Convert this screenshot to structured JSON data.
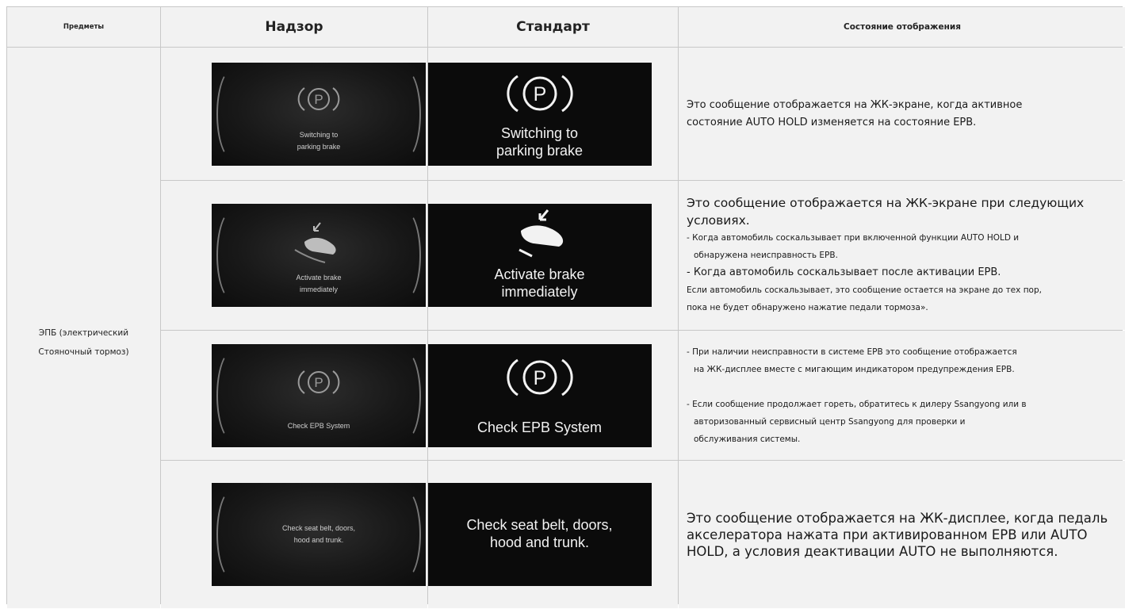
{
  "header": {
    "items": "Предметы",
    "supervision": "Надзор",
    "standard": "Стандарт",
    "display_state": "Состояние отображения"
  },
  "item": {
    "line1": "ЭПБ (электрический",
    "line2": "Стояночный тормоз)"
  },
  "rows": [
    {
      "sup_caption": "Switching to\nparking brake",
      "std_caption": "Switching to\nparking brake",
      "icon": "parking-brake-icon",
      "desc_line1": "Это сообщение отображается на ЖК-экране, когда активное",
      "desc_line2": "состояние AUTO HOLD изменяется на состояние EPB."
    },
    {
      "sup_caption": "Activate brake\nimmediately",
      "std_caption": "Activate brake\nimmediately",
      "icon": "brake-pedal-icon",
      "desc_heading": "Это сообщение отображается на ЖК-экране при следующих условиях.",
      "desc_bullet1_a": "- Когда автомобиль соскальзывает при включенной функции AUTO HOLD и",
      "desc_bullet1_b": "обнаружена неисправность EPB.",
      "desc_bullet2": "- Когда автомобиль соскальзывает после активации EPB.",
      "desc_note_a": "Если автомобиль соскальзывает, это сообщение остается на экране до тех пор,",
      "desc_note_b": "пока не будет обнаружено нажатие педали тормоза»."
    },
    {
      "sup_caption": "Check EPB System",
      "std_caption": "Check EPB System",
      "icon": "parking-brake-icon",
      "desc_bullet1_a": "- При наличии неисправности в системе EPB это сообщение отображается",
      "desc_bullet1_b": "на ЖК-дисплее вместе с мигающим индикатором предупреждения EPB.",
      "desc_bullet2_a": "- Если сообщение продолжает гореть, обратитесь к дилеру Ssangyong или в",
      "desc_bullet2_b": "авторизованный сервисный центр Ssangyong для проверки и",
      "desc_bullet2_c": "обслуживания системы."
    },
    {
      "sup_caption": "Check seat belt, doors,\nhood and trunk.",
      "std_caption": "Check seat belt, doors,\nhood and trunk.",
      "desc": "Это сообщение отображается на ЖК-дисплее, когда педаль акселератора нажата при активированном EPB или AUTO HOLD, а условия деактивации AUTO не выполняются."
    }
  ],
  "colors": {
    "cell_bg": "#f2f2f2",
    "grid_line": "#c8c8c8",
    "screen_bg": "#0b0b0b"
  }
}
